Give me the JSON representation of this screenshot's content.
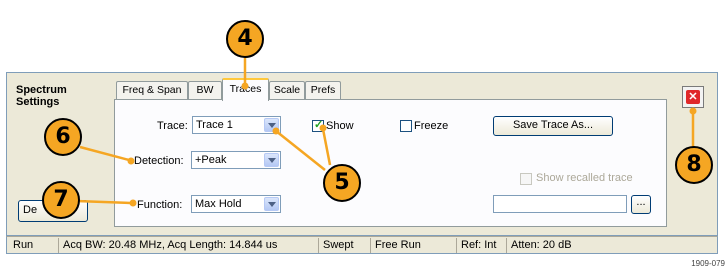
{
  "settings": {
    "title": "Spectrum Settings"
  },
  "tabs": [
    {
      "label": "Freq & Span"
    },
    {
      "label": "BW"
    },
    {
      "label": "Traces",
      "active": true
    },
    {
      "label": "Scale"
    },
    {
      "label": "Prefs"
    }
  ],
  "trace": {
    "label": "Trace:",
    "value": "Trace 1",
    "show_label": "Show",
    "show_checked": true,
    "freeze_label": "Freeze",
    "freeze_checked": false,
    "save_button": "Save Trace As..."
  },
  "detection": {
    "label": "Detection:",
    "value": "+Peak"
  },
  "function": {
    "label": "Function:",
    "value": "Max Hold"
  },
  "recalled": {
    "label": "Show recalled trace",
    "checked": false,
    "enabled": false
  },
  "browse_button": "...",
  "left_button": "De",
  "status": {
    "run": "Run",
    "acq": "Acq BW: 20.48 MHz, Acq Length: 14.844 us",
    "mode": "Swept",
    "trigger": "Free Run",
    "ref": "Ref: Int",
    "atten": "Atten: 20 dB"
  },
  "callouts": [
    "4",
    "5",
    "6",
    "7",
    "8"
  ],
  "figure_id": "1909-079",
  "colors": {
    "callout": "#f5a623",
    "close": "#e0282a",
    "active_tab_border": "#ffc83c"
  }
}
